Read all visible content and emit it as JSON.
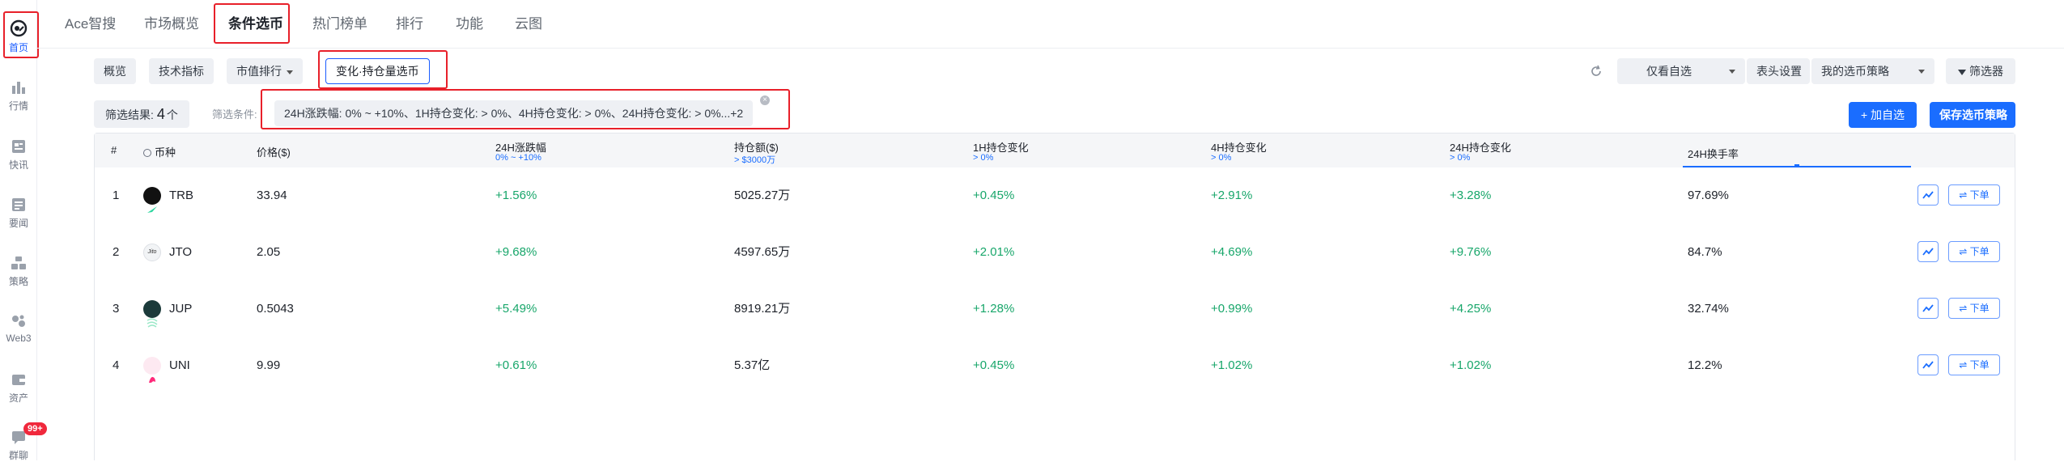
{
  "sidebar": {
    "items": [
      {
        "label": "首页",
        "icon": "home-logo-icon",
        "active": true
      },
      {
        "label": "行情",
        "icon": "market-chart-icon"
      },
      {
        "label": "快讯",
        "icon": "news-flash-icon"
      },
      {
        "label": "要闻",
        "icon": "headlines-icon"
      },
      {
        "label": "策略",
        "icon": "strategy-icon"
      },
      {
        "label": "Web3",
        "icon": "web3-icon"
      },
      {
        "label": "资产",
        "icon": "wallet-icon"
      },
      {
        "label": "群聊",
        "icon": "chat-icon",
        "badge": "99+"
      }
    ]
  },
  "nav": {
    "tabs": [
      "Ace智搜",
      "市场概览",
      "条件选币",
      "热门榜单",
      "排行",
      "功能",
      "云图"
    ],
    "active_index": 2
  },
  "toolbar": {
    "tabs": [
      "概览",
      "技术指标",
      "市值排行",
      "变化·持仓量选币"
    ],
    "right": {
      "watchlist_only": "仅看自选",
      "header_settings": "表头设置",
      "my_strategy": "我的选币策略",
      "filter": "筛选器"
    }
  },
  "filter": {
    "result_label": "筛选结果:",
    "result_count": "4",
    "result_unit": "个",
    "condition_label": "筛选条件:",
    "condition_text": "24H涨跌幅:  0% ~ +10%、1H持仓变化:  > 0%、4H持仓变化:  > 0%、24H持仓变化:  > 0%...+2"
  },
  "actions": {
    "add_watch": "+ 加自选",
    "save_strategy": "保存选币策略"
  },
  "table": {
    "columns": [
      {
        "title": "#"
      },
      {
        "title": "币种"
      },
      {
        "title": "价格($)"
      },
      {
        "title": "24H涨跌幅",
        "sub": "0% ~ +10%"
      },
      {
        "title": "持仓额($)",
        "sub": "> $3000万"
      },
      {
        "title": "1H持仓变化",
        "sub": "> 0%"
      },
      {
        "title": "4H持仓变化",
        "sub": "> 0%"
      },
      {
        "title": "24H持仓变化",
        "sub": "> 0%"
      },
      {
        "title": "24H换手率"
      }
    ],
    "order_label": "⇌ 下单",
    "rows": [
      {
        "rank": "1",
        "symbol": "TRB",
        "price": "33.94",
        "change24h": "+1.56%",
        "oi": "5025.27万",
        "oi1h": "+0.45%",
        "oi4h": "+2.91%",
        "oi24h": "+3.28%",
        "turnover": "97.69%",
        "logo_color": "#111111"
      },
      {
        "rank": "2",
        "symbol": "JTO",
        "price": "2.05",
        "change24h": "+9.68%",
        "oi": "4597.65万",
        "oi1h": "+2.01%",
        "oi4h": "+4.69%",
        "oi24h": "+9.76%",
        "turnover": "84.7%",
        "logo_color": "#f2f4f6"
      },
      {
        "rank": "3",
        "symbol": "JUP",
        "price": "0.5043",
        "change24h": "+5.49%",
        "oi": "8919.21万",
        "oi1h": "+1.28%",
        "oi4h": "+0.99%",
        "oi24h": "+4.25%",
        "turnover": "32.74%",
        "logo_color": "#1b3a3a"
      },
      {
        "rank": "4",
        "symbol": "UNI",
        "price": "9.99",
        "change24h": "+0.61%",
        "oi": "5.37亿",
        "oi1h": "+0.45%",
        "oi4h": "+1.02%",
        "oi24h": "+1.02%",
        "turnover": "12.2%",
        "logo_color": "#fde9f1"
      }
    ]
  },
  "colors": {
    "accent": "#1a6dff",
    "positive": "#17a66a",
    "highlight_box": "#e8202a"
  }
}
